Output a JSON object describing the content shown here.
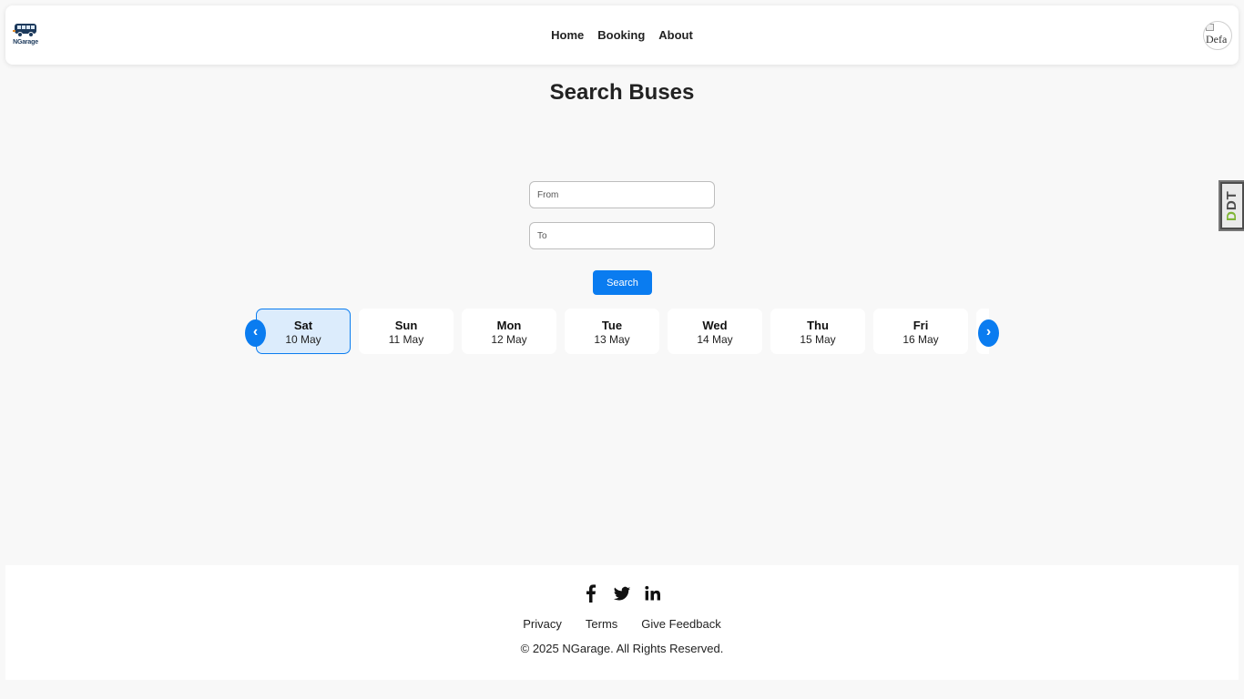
{
  "brand": {
    "logo_text": "NGarage",
    "logo_icon": "bus-icon"
  },
  "nav": {
    "items": [
      {
        "label": "Home"
      },
      {
        "label": "Booking"
      },
      {
        "label": "About"
      }
    ],
    "avatar_alt": "Defa"
  },
  "page": {
    "title": "Search Buses"
  },
  "search": {
    "from_placeholder": "From",
    "to_placeholder": "To",
    "button_label": "Search"
  },
  "dates": {
    "prev_label": "‹",
    "next_label": "›",
    "selected_index": 0,
    "items": [
      {
        "day": "Sat",
        "date": "10 May"
      },
      {
        "day": "Sun",
        "date": "11 May"
      },
      {
        "day": "Mon",
        "date": "12 May"
      },
      {
        "day": "Tue",
        "date": "13 May"
      },
      {
        "day": "Wed",
        "date": "14 May"
      },
      {
        "day": "Thu",
        "date": "15 May"
      },
      {
        "day": "Fri",
        "date": "16 May"
      }
    ]
  },
  "side_badge": {
    "label_a": "D",
    "label_b": "DT"
  },
  "footer": {
    "social": [
      "facebook-icon",
      "twitter-icon",
      "linkedin-icon"
    ],
    "links": [
      {
        "label": "Privacy"
      },
      {
        "label": "Terms"
      },
      {
        "label": "Give Feedback"
      }
    ],
    "copyright": "© 2025 NGarage. All Rights Reserved."
  },
  "colors": {
    "accent": "#0a7cf0",
    "selected_bg": "#dcecfc",
    "page_bg": "#f8f8f8"
  }
}
